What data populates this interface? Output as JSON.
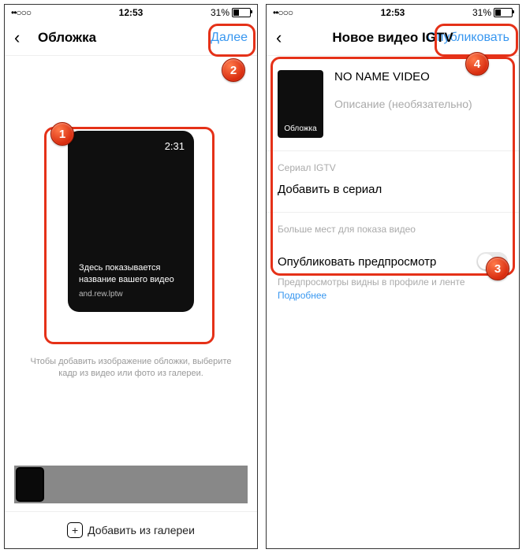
{
  "status": {
    "signal": "••○○○",
    "time": "12:53",
    "battery_pct": "31%"
  },
  "left": {
    "nav": {
      "title": "Обложка",
      "action": "Далее"
    },
    "card": {
      "duration": "2:31",
      "caption": "Здесь показывается название вашего видео",
      "user": "and.rew.lptw"
    },
    "hint": "Чтобы добавить изображение обложки, выберите кадр из видео или фото из галереи.",
    "add": "Добавить из галереи"
  },
  "right": {
    "nav": {
      "title": "Новое видео IGTV",
      "action": "Опубликовать"
    },
    "mini_cover": "Обложка",
    "title_value": "NO NAME VIDEO",
    "desc_placeholder": "Описание (необязательно)",
    "series": {
      "label": "Сериал IGTV",
      "row": "Добавить в сериал"
    },
    "more": {
      "label": "Больше мест для показа видео",
      "row": "Опубликовать предпросмотр",
      "sub": "Предпросмотры видны в профиле и ленте",
      "link": "Подробнее"
    }
  },
  "badges": {
    "b1": "1",
    "b2": "2",
    "b3": "3",
    "b4": "4"
  }
}
